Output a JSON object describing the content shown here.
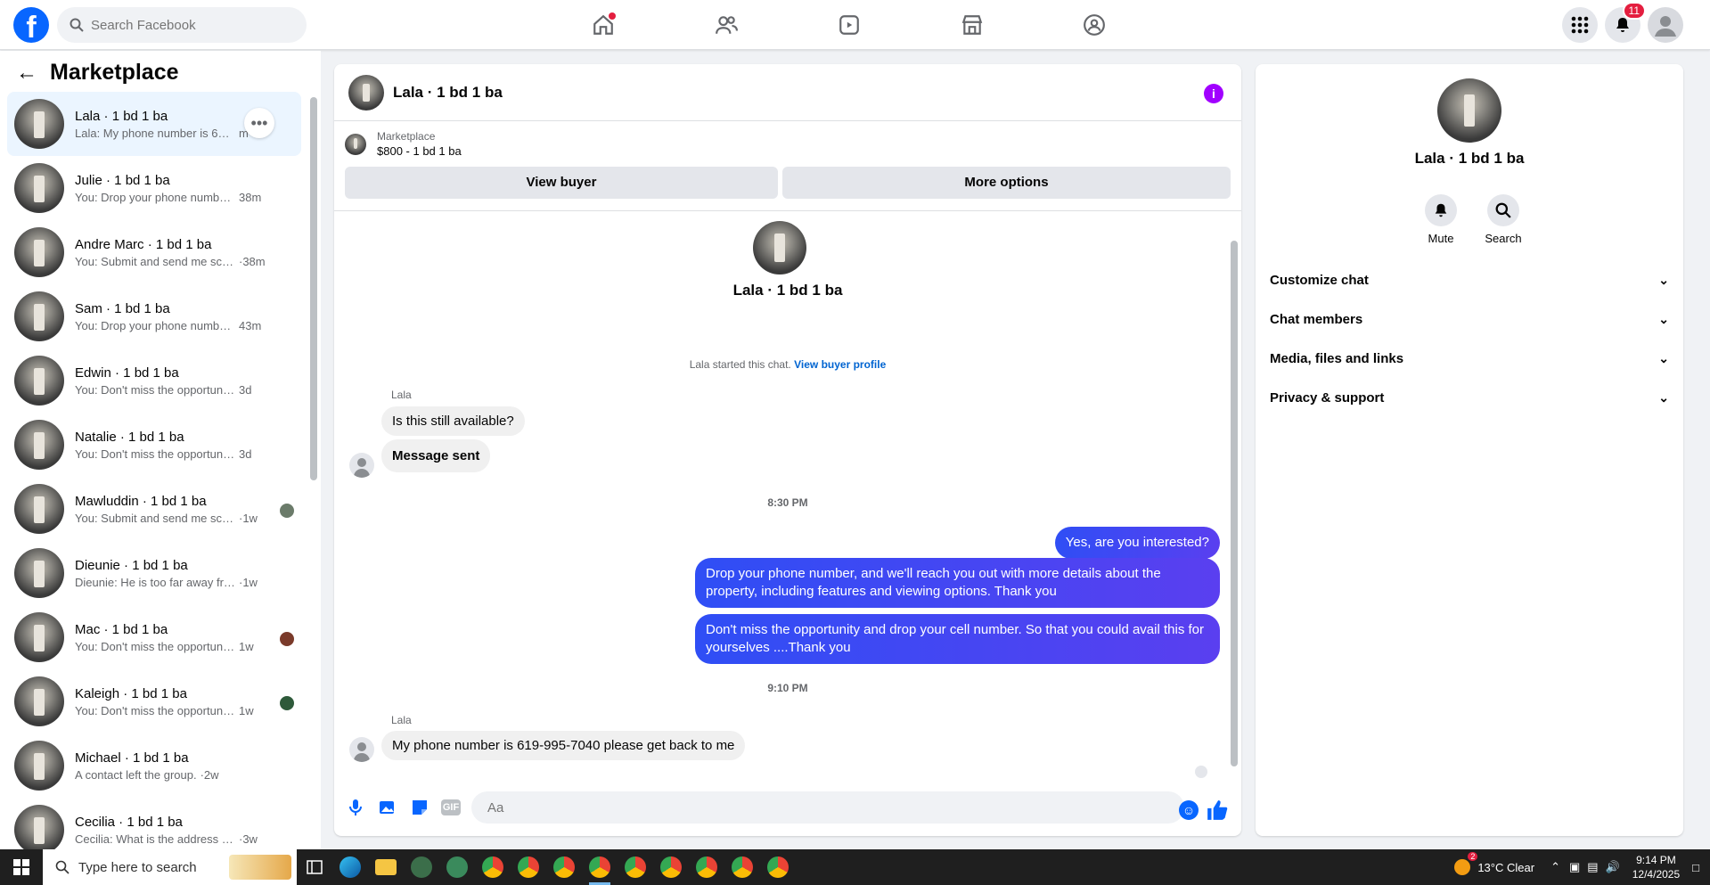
{
  "topbar": {
    "logo": "f",
    "search_placeholder": "Search Facebook",
    "notif_count": "11",
    "nav_icons": [
      "home-icon",
      "friends-icon",
      "video-icon",
      "marketplace-icon",
      "groups-icon"
    ]
  },
  "left": {
    "title": "Marketplace",
    "conversations": [
      {
        "name": "Lala · 1 bd 1 ba",
        "preview": "Lala: My phone number is 619-995",
        "time": "m"
      },
      {
        "name": "Julie · 1 bd 1 ba",
        "preview": "You: Drop your phone number, a...",
        "time": "38m"
      },
      {
        "name": "Andre Marc · 1 bd 1 ba",
        "preview": "You: Submit and send me screen ...",
        "time": "·38m"
      },
      {
        "name": "Sam · 1 bd 1 ba",
        "preview": "You: Drop your phone number, a...",
        "time": "43m"
      },
      {
        "name": "Edwin · 1 bd 1 ba",
        "preview": "You: Don't miss the opportunity an...",
        "time": "3d"
      },
      {
        "name": "Natalie · 1 bd 1 ba",
        "preview": "You: Don't miss the opportunity an...",
        "time": "3d"
      },
      {
        "name": "Mawluddin · 1 bd 1 ba",
        "preview": "You: Submit and send me scree...",
        "time": "·1w"
      },
      {
        "name": "Dieunie · 1 bd 1 ba",
        "preview": "Dieunie: He is too far away from m...",
        "time": "·1w"
      },
      {
        "name": "Mac · 1 bd 1 ba",
        "preview": "You: Don't miss the opportunity ...",
        "time": "1w"
      },
      {
        "name": "Kaleigh · 1 bd 1 ba",
        "preview": "You: Don't miss the opportunity ...",
        "time": "1w"
      },
      {
        "name": "Michael · 1 bd 1 ba",
        "preview": "A contact left the group.",
        "time": "·2w"
      },
      {
        "name": "Cecilia · 1 bd 1 ba",
        "preview": "Cecilia: What is the address so I ca...",
        "time": "·3w"
      }
    ]
  },
  "chat": {
    "title": "Lala · 1 bd 1 ba",
    "listing_source": "Marketplace",
    "listing_price": "$800 - 1 bd 1 ba",
    "view_buyer": "View buyer",
    "more_options": "More options",
    "intro_name": "Lala · 1 bd 1 ba",
    "started_text": "Lala started this chat.",
    "view_profile": "View buyer profile",
    "sender1": "Lala",
    "msg_in_1": "Is this still available?",
    "msg_in_2": "Message sent",
    "time1": "8:30 PM",
    "msg_out_1": "Yes, are you interested?",
    "msg_out_2": "Drop your phone number, and we'll reach you out with more details about the property, including features and viewing options.  Thank you",
    "msg_out_3": "Don't miss the opportunity and drop your cell number. So that you could  avail this for yourselves ....Thank you",
    "time2": "9:10 PM",
    "sender2": "Lala",
    "msg_in_3": "My phone number is 619-995-7040 please get back to me",
    "composer_placeholder": "Aa"
  },
  "right": {
    "name": "Lala · 1 bd 1 ba",
    "mute": "Mute",
    "search": "Search",
    "sections": [
      "Customize chat",
      "Chat members",
      "Media, files and links",
      "Privacy & support"
    ]
  },
  "taskbar": {
    "search_placeholder": "Type here to search",
    "weather": "13°C  Clear",
    "weather_badge": "2",
    "time": "9:14 PM",
    "date": "12/4/2025"
  },
  "colors": {
    "brand": "#0866ff",
    "bubble_out": "#3b4ef5",
    "info": "#a100ff"
  }
}
